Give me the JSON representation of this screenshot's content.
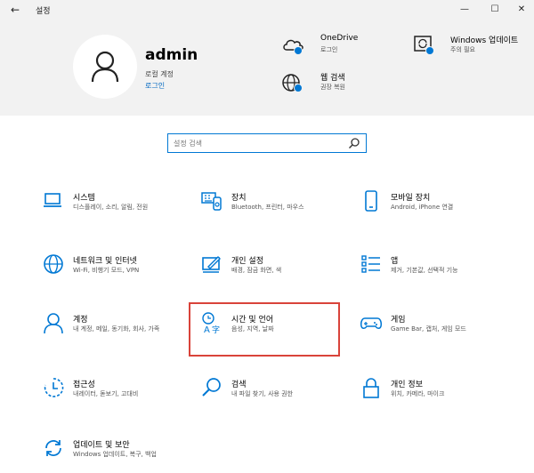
{
  "window": {
    "back_glyph": "←",
    "title": "설정",
    "minimize_glyph": "—",
    "maximize_glyph": "☐",
    "close_glyph": "✕"
  },
  "account": {
    "username": "admin",
    "account_type": "로컬 계정",
    "signin_link": "로그인"
  },
  "header_items": {
    "onedrive": {
      "title": "OneDrive",
      "subtitle": "로그인"
    },
    "web_search": {
      "title": "웹 검색",
      "subtitle": "권장 복원"
    },
    "windows_update": {
      "title": "Windows 업데이트",
      "subtitle": "주의 필요"
    }
  },
  "search": {
    "placeholder": "설정 검색"
  },
  "categories": [
    {
      "title": "시스템",
      "subtitle": "디스플레이, 소리, 알림, 전원"
    },
    {
      "title": "장치",
      "subtitle": "Bluetooth, 프린터, 마우스"
    },
    {
      "title": "모바일 장치",
      "subtitle": "Android, iPhone 연결"
    },
    {
      "title": "네트워크 및 인터넷",
      "subtitle": "Wi-Fi, 비행기 모드, VPN"
    },
    {
      "title": "개인 설정",
      "subtitle": "배경, 잠금 화면, 색"
    },
    {
      "title": "앱",
      "subtitle": "제거, 기본값, 선택적 기능"
    },
    {
      "title": "계정",
      "subtitle": "내 계정, 메일, 동기화, 회사, 가족"
    },
    {
      "title": "시간 및 언어",
      "subtitle": "음성, 지역, 날짜"
    },
    {
      "title": "게임",
      "subtitle": "Game Bar, 캡처, 게임 모드"
    },
    {
      "title": "접근성",
      "subtitle": "내레이터, 돋보기, 고대비"
    },
    {
      "title": "검색",
      "subtitle": "내 파일 찾기, 사용 권한"
    },
    {
      "title": "개인 정보",
      "subtitle": "위치, 카메라, 마이크"
    },
    {
      "title": "업데이트 및 보안",
      "subtitle": "Windows 업데이트, 복구, 백업"
    }
  ],
  "colors": {
    "accent": "#0067c0",
    "icon_blue": "#0078d4",
    "header_bg": "#f2f2f2",
    "highlight_border": "#d9433a"
  }
}
